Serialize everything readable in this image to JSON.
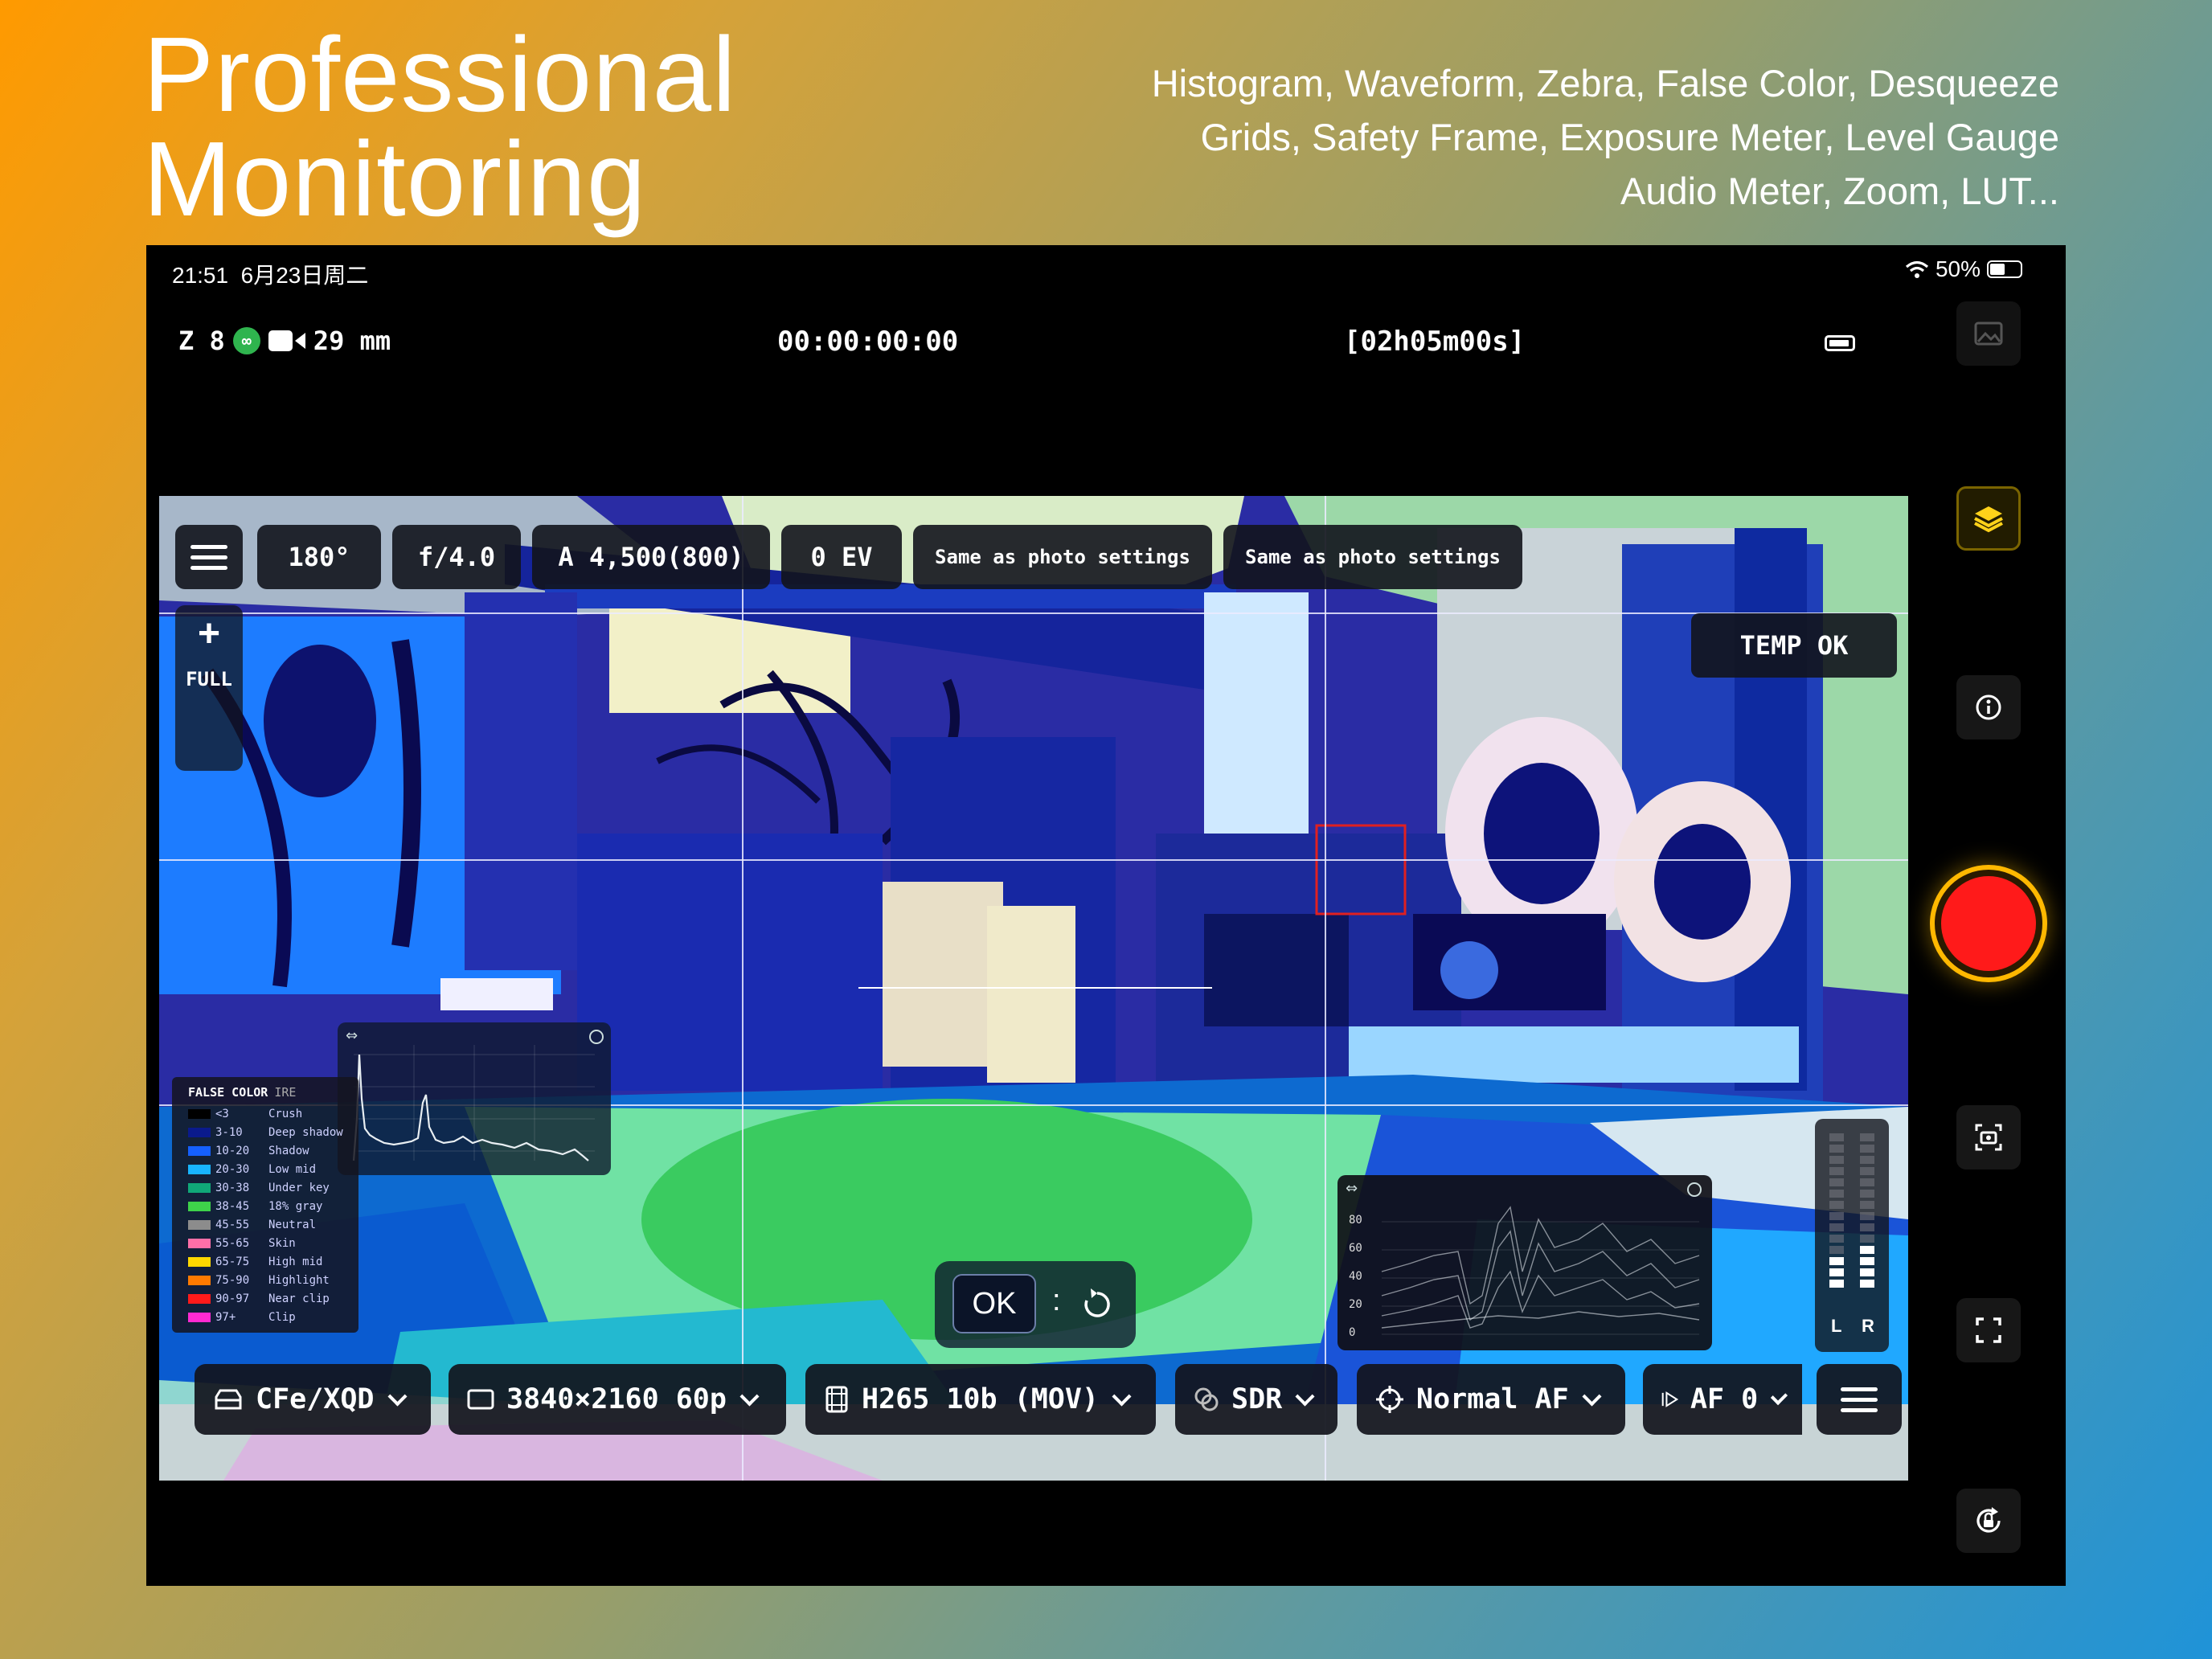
{
  "headline": {
    "line1": "Professional",
    "line2": "Monitoring"
  },
  "features": [
    "Histogram, Waveform, Zebra, False Color, Desqueeze",
    "Grids, Safety Frame, Exposure Meter, Level Gauge",
    "Audio Meter, Zoom, LUT..."
  ],
  "status_bar": {
    "time": "21:51",
    "date": "6月23日周二",
    "battery": "50%"
  },
  "camera": {
    "model": "Z 8",
    "focal_length": "29 mm",
    "timecode": "00:00:00:00",
    "remaining": "[02h05m00s]"
  },
  "exposure": {
    "shutter": "180°",
    "aperture": "f/4.0",
    "iso": "A 4,500(800)",
    "ev": "0 EV",
    "wb": "Same as photo settings",
    "picture_control": "Same as photo settings"
  },
  "zoom": {
    "plus": "+",
    "label": "FULL"
  },
  "temp_status": "TEMP OK",
  "false_color": {
    "title": "FALSE COLOR",
    "unit": "IRE",
    "bands": [
      {
        "range": "<3",
        "name": "Crush",
        "color": "#000000"
      },
      {
        "range": "3-10",
        "name": "Deep shadow",
        "color": "#0a1a8c"
      },
      {
        "range": "10-20",
        "name": "Shadow",
        "color": "#1560ff"
      },
      {
        "range": "20-30",
        "name": "Low mid",
        "color": "#18b4ff"
      },
      {
        "range": "30-38",
        "name": "Under key",
        "color": "#10a878"
      },
      {
        "range": "38-45",
        "name": "18% gray",
        "color": "#3ed24a"
      },
      {
        "range": "45-55",
        "name": "Neutral",
        "color": "#8c8c8c"
      },
      {
        "range": "55-65",
        "name": "Skin",
        "color": "#ff6fa8"
      },
      {
        "range": "65-75",
        "name": "High mid",
        "color": "#ffd800"
      },
      {
        "range": "75-90",
        "name": "Highlight",
        "color": "#ff7a00"
      },
      {
        "range": "90-97",
        "name": "Near clip",
        "color": "#ff1a1a"
      },
      {
        "range": "97+",
        "name": "Clip",
        "color": "#ff2ad2"
      }
    ]
  },
  "waveform": {
    "labels": [
      "80",
      "60",
      "40",
      "20",
      "0"
    ]
  },
  "audio_meter": {
    "left_label": "L",
    "right_label": "R",
    "left_level": 0.19,
    "right_level": 0.27
  },
  "af_confirm": {
    "ok": "OK",
    "separator": ":"
  },
  "bottom_bar": {
    "media": "CFe/XQD",
    "resolution": "3840×2160 60p",
    "codec": "H265 10b (MOV)",
    "dynamic_range": "SDR",
    "af_mode": "Normal AF",
    "af_area": "AF 0"
  },
  "accent_colors": {
    "record": "#ff1a1a",
    "layers": "#ffd21a",
    "link": "#2fb44e"
  }
}
